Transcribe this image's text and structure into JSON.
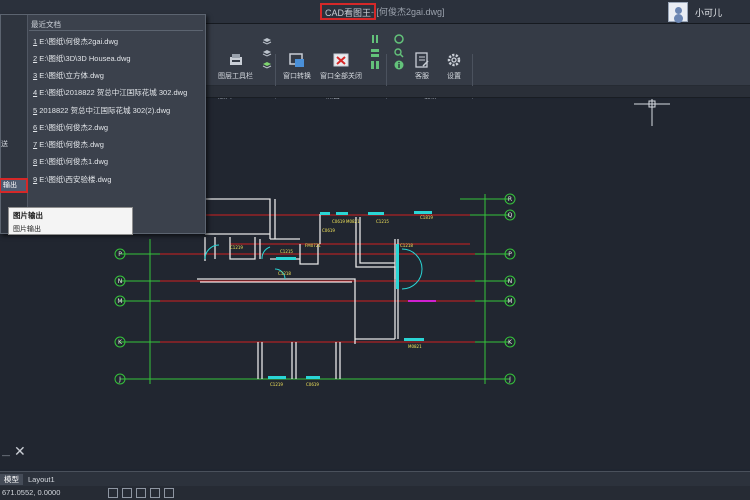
{
  "title_bar": {
    "app_name": "CAD看图王",
    "file_name": "- [何俊杰2gai.dwg]",
    "user_name": "小可儿"
  },
  "ribbon": {
    "buttons": [
      {
        "label": "图层工具栏",
        "icon": "layers-toolbar-icon"
      },
      {
        "label": "窗口转换",
        "icon": "window-switch-icon"
      },
      {
        "label": "窗口全部关闭",
        "icon": "close-all-windows-icon"
      },
      {
        "label": "客服",
        "icon": "customer-service-icon"
      },
      {
        "label": "设置",
        "icon": "gear-icon"
      }
    ],
    "groups": [
      "图层",
      "窗口",
      "帮助"
    ]
  },
  "file_menu": {
    "left_items": [
      "送",
      "输出"
    ],
    "recent_title": "最近文档",
    "recent_files": [
      {
        "index": "1",
        "path": "E:\\图纸\\何俊杰2gai.dwg"
      },
      {
        "index": "2",
        "path": "E:\\图纸\\3D\\3D Housea.dwg"
      },
      {
        "index": "3",
        "path": "E:\\图纸\\立方体.dwg"
      },
      {
        "index": "4",
        "path": "E:\\图纸\\2018822 贺总中江国际花城 302.dwg"
      },
      {
        "index": "5",
        "path": "2018822 贺总中江国际花城 302(2).dwg"
      },
      {
        "index": "6",
        "path": "E:\\图纸\\何俊杰2.dwg"
      },
      {
        "index": "7",
        "path": "E:\\图纸\\何俊杰.dwg"
      },
      {
        "index": "8",
        "path": "E:\\图纸\\何俊杰1.dwg"
      },
      {
        "index": "9",
        "path": "E:\\图纸\\西安验楼.dwg"
      }
    ]
  },
  "tooltip": {
    "title": "图片输出",
    "description": "图片输出"
  },
  "drawing": {
    "axis_right": [
      "R",
      "Q",
      "P",
      "N",
      "M",
      "K",
      "J"
    ],
    "axis_left": [
      "P",
      "N",
      "M",
      "K",
      "J"
    ],
    "labels": [
      "C0619",
      "M0821",
      "C1215",
      "C1819",
      "C1215",
      "FM0721",
      "C1218",
      "C1218",
      "M0821",
      "C1219",
      "C0619",
      "C1219",
      "C0619"
    ]
  },
  "tabs": [
    "模型",
    "Layout1"
  ],
  "status": {
    "coords": "671.0552, 0.0000"
  },
  "colors": {
    "highlight_red": "#d52828",
    "axis_green": "#35c43a",
    "wall_white": "#e6e6e6",
    "line_red": "#d02020",
    "window_cyan": "#2ad5d5",
    "door_magenta": "#d020d0"
  }
}
